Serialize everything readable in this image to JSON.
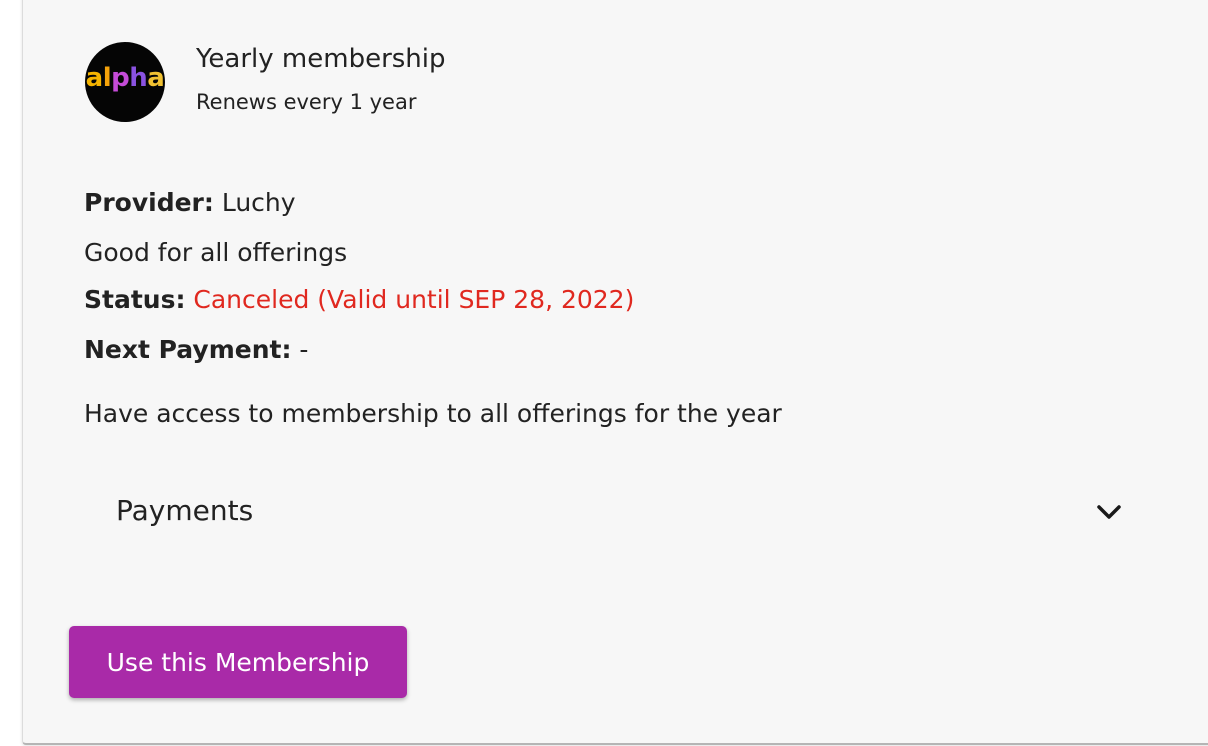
{
  "membership": {
    "logo_text": "alpha",
    "title": "Yearly membership",
    "renewal": "Renews every 1 year",
    "provider_label": "Provider:",
    "provider_value": "Luchy",
    "scope": "Good for all offerings",
    "status_label": "Status:",
    "status_value": "Canceled (Valid until SEP 28, 2022)",
    "next_payment_label": "Next Payment:",
    "next_payment_value": "-",
    "description": "Have access to membership to all offerings for the year"
  },
  "payments": {
    "label": "Payments",
    "expanded": false,
    "icon": "chevron-down-icon"
  },
  "actions": {
    "use_label": "Use this Membership"
  },
  "colors": {
    "status_canceled": "#e0281f",
    "primary_button": "#a92aa8",
    "card_background": "#f7f7f7"
  }
}
